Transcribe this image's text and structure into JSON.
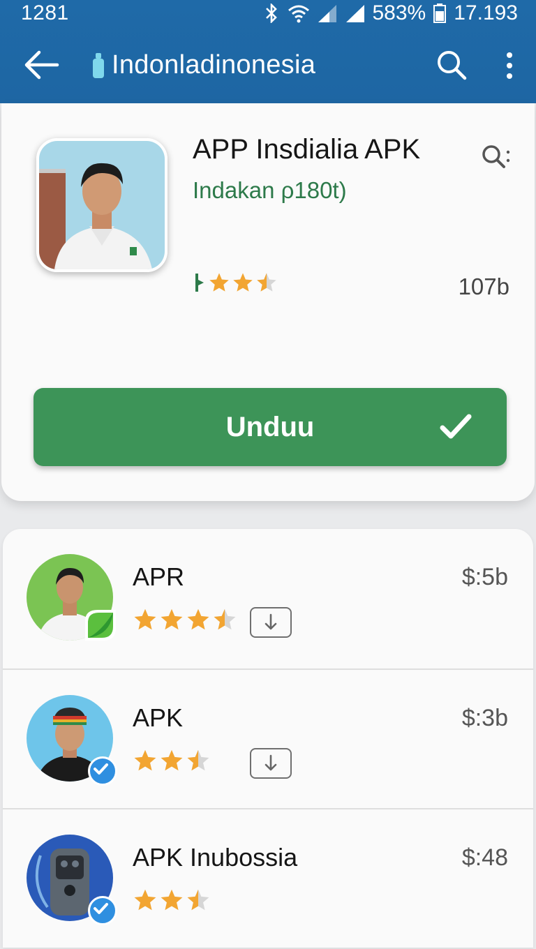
{
  "status_bar": {
    "time": "1281",
    "battery": "583%",
    "clock": "17.193"
  },
  "app_bar": {
    "title": "Indonladinonesia",
    "icons": [
      "back-arrow-icon",
      "bottle-icon",
      "search-icon",
      "more-vert-icon"
    ]
  },
  "app": {
    "name": "APP Insdialia APK",
    "subtitle": "Indakan ρ180t)",
    "rating_stars": 2.5,
    "size": "107b",
    "install_label": "Unduu"
  },
  "list": [
    {
      "name": "APR",
      "price": "$:5b",
      "rating_stars": 3.5,
      "avatar": "green-portrait",
      "badge": "leaf"
    },
    {
      "name": "APK",
      "price": "$:3b",
      "rating_stars": 2.5,
      "avatar": "blue-portrait",
      "badge": "verified"
    },
    {
      "name": "APK Inubossia",
      "price": "$:48",
      "rating_stars": 2.5,
      "avatar": "device",
      "badge": "verified"
    }
  ],
  "colors": {
    "app_bar": "#1f6aa8",
    "install_button": "#3d9458",
    "subtitle_green": "#2d7a4a",
    "star_gold": "#f2a532",
    "verified_blue": "#2f8fe0"
  }
}
